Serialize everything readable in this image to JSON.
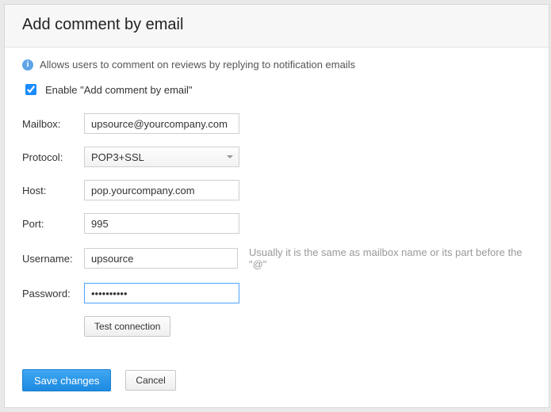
{
  "header": {
    "title": "Add comment by email"
  },
  "info": {
    "text": "Allows users to comment on reviews by replying to notification emails"
  },
  "enable": {
    "label": "Enable \"Add comment by email\"",
    "checked": true
  },
  "fields": {
    "mailbox": {
      "label": "Mailbox:",
      "value": "upsource@yourcompany.com"
    },
    "protocol": {
      "label": "Protocol:",
      "value": "POP3+SSL"
    },
    "host": {
      "label": "Host:",
      "value": "pop.yourcompany.com"
    },
    "port": {
      "label": "Port:",
      "value": "995"
    },
    "username": {
      "label": "Username:",
      "value": "upsource",
      "hint": "Usually it is the same as mailbox name or its part before the \"@\""
    },
    "password": {
      "label": "Password:",
      "value": "••••••••••"
    }
  },
  "buttons": {
    "test": "Test connection",
    "save": "Save changes",
    "cancel": "Cancel"
  }
}
